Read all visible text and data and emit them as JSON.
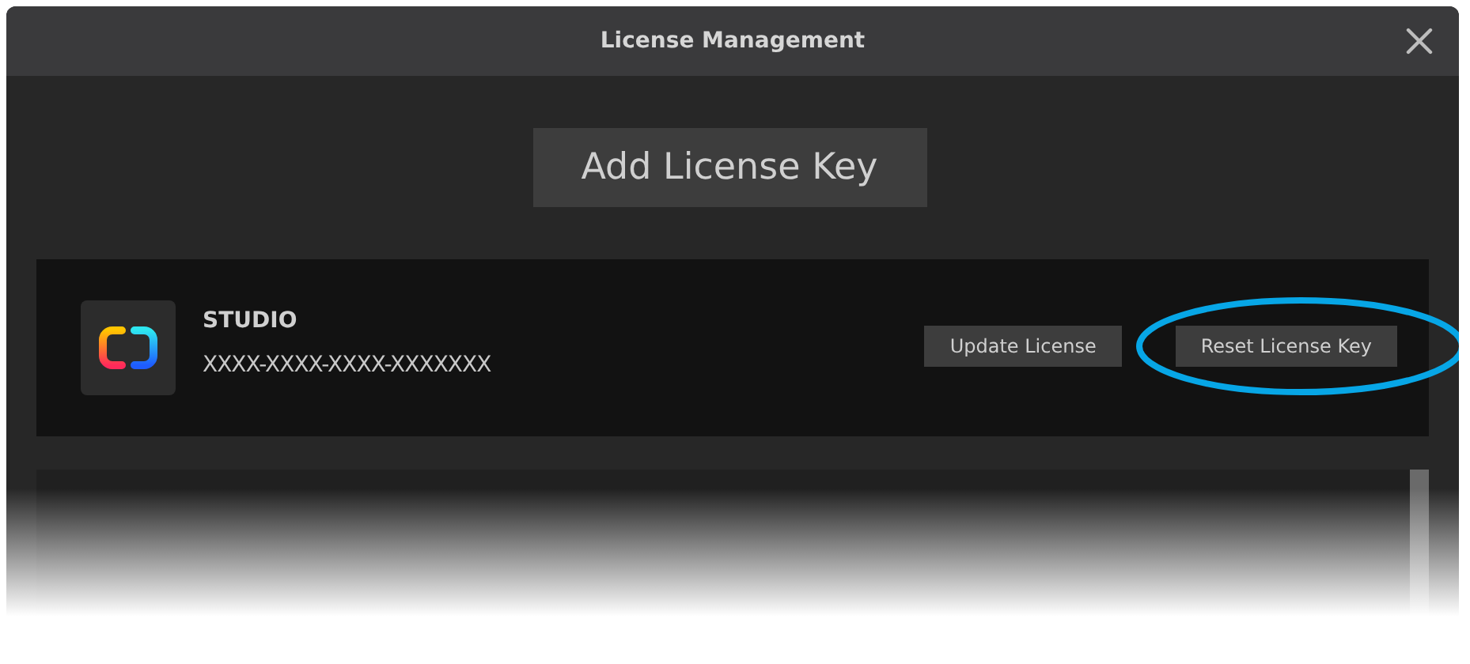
{
  "window": {
    "title": "License Management"
  },
  "add_button": {
    "label": "Add License Key"
  },
  "licenses": [
    {
      "product": "STUDIO",
      "key": "XXXX-XXXX-XXXX-XXXXXXX",
      "buttons": [
        {
          "label": "Update License",
          "kind": "plain"
        },
        {
          "label": "Reset License Key",
          "kind": "circled"
        }
      ]
    }
  ]
}
